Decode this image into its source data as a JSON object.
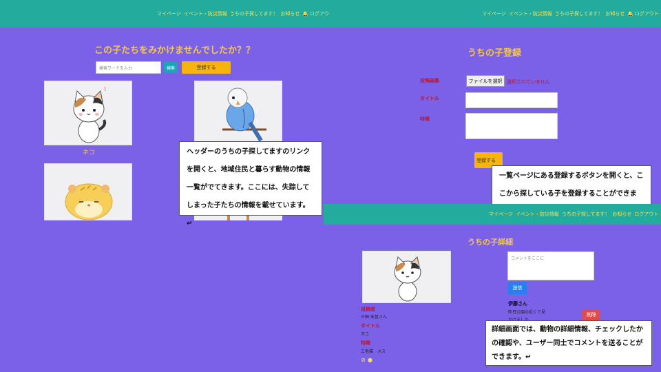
{
  "nav": {
    "items": [
      "マイページ",
      "イベント・防災情報",
      "うちの子探してます！",
      "お知らせ",
      "ログアウト"
    ]
  },
  "list_page": {
    "title": "この子たちをみかけませんでしたか？？",
    "search_placeholder": "検索ワードを入力",
    "search_button": "検索",
    "register_button": "登録する",
    "pet_label": "ネコ",
    "note": "ヘッダーのうちの子探してますのリンクを開くと、地域住民と暮らす動物の情報一覧がでてきます。ここには、失踪してしまった子たちの情報を載せています。↵"
  },
  "register_page": {
    "title": "うちの子登録",
    "image_label": "投稿画像",
    "file_button": "ファイルを選択",
    "file_status": "選択されていません",
    "title_label": "タイトル",
    "feature_label": "特徴",
    "submit_button": "登録する",
    "note": "一覧ページにある登録するボタンを開くと、ここから探している子を登録することができます。↵"
  },
  "detail_page": {
    "title": "うちの子詳細",
    "comment_placeholder": "コメントをここに",
    "send_button": "送信",
    "poster_label": "投稿者",
    "poster_value": "三田 朱音さん",
    "title_label": "タイトル",
    "title_value": "ネコ",
    "feature_label": "特徴",
    "feature_value": "三毛猫　メス",
    "comment_user": "伊藤さん",
    "comment_text_1": "昨日公園の近くで見",
    "comment_text_2": "かけました",
    "delete_button": "削除",
    "note": "詳細画面では、動物の詳細情報、チェックしたかの確認や、ユーザー同士でコメントを送ることができます。↵"
  }
}
